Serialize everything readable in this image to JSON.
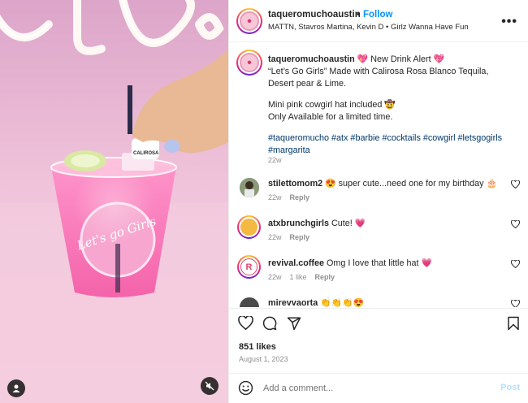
{
  "post": {
    "username": "taqueromuchoaustin",
    "follow_label": "Follow",
    "dot": "•",
    "subline": "MATTN, Stavros Martina, Kevin D • Girlz Wanna Have Fun",
    "more_label": "•••",
    "caption_user": "taqueromuchoaustin",
    "caption_lines": [
      "💖 New Drink Alert 💖",
      "“Let’s Go Girls” Made with Calirosa Rosa Blanco Tequila,",
      "Desert pear & Lime.",
      "Mini pink cowgirl hat included 🤠",
      "Only Available for a limited time.",
      "#taqueromucho #atx #barbie #cocktails #cowgirl #letsgogirls",
      "#margarita"
    ],
    "caption_time": "22w",
    "comments": [
      {
        "user": "stilettomom2",
        "text": "😍 super cute...need one for my birthday 🎂",
        "time": "22w",
        "likes": "",
        "reply": "Reply"
      },
      {
        "user": "atxbrunchgirls",
        "text": "Cute! 💗",
        "time": "22w",
        "likes": "",
        "reply": "Reply"
      },
      {
        "user": "revival.coffee",
        "text": "Omg I love that little hat 💗",
        "time": "22w",
        "likes": "1 like",
        "reply": "Reply"
      },
      {
        "user": "mirevvaorta",
        "text": "👏👏👏😍",
        "time": "",
        "likes": "",
        "reply": ""
      }
    ],
    "likes": "851 likes",
    "date": "August 1, 2023",
    "comment_placeholder": "Add a comment...",
    "post_label": "Post"
  },
  "media": {
    "cup_sticker_text": "Let's go Girls",
    "hat_brand": "CALIROSA"
  },
  "colors": {
    "follow": "#0095f6",
    "hashtag": "#00376b",
    "muted": "#8e8e8e",
    "post_disabled": "#b2dffc"
  }
}
